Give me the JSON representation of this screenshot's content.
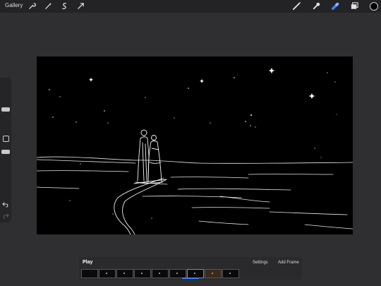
{
  "toolbar": {
    "gallery_label": "Gallery",
    "left_tools": [
      "wrench-icon",
      "magic-wand-icon",
      "selection-icon",
      "transform-icon"
    ],
    "right_tools": [
      "brush-icon",
      "smudge-icon",
      "eraser-icon",
      "layers-icon"
    ],
    "active_tool": "eraser-icon",
    "active_color": "#000000",
    "accent": "#3b7cff"
  },
  "animation": {
    "play_label": "Play",
    "settings_label": "Settings",
    "add_frame_label": "Add Frame",
    "frame_count": 9,
    "selected_frame": 7
  }
}
